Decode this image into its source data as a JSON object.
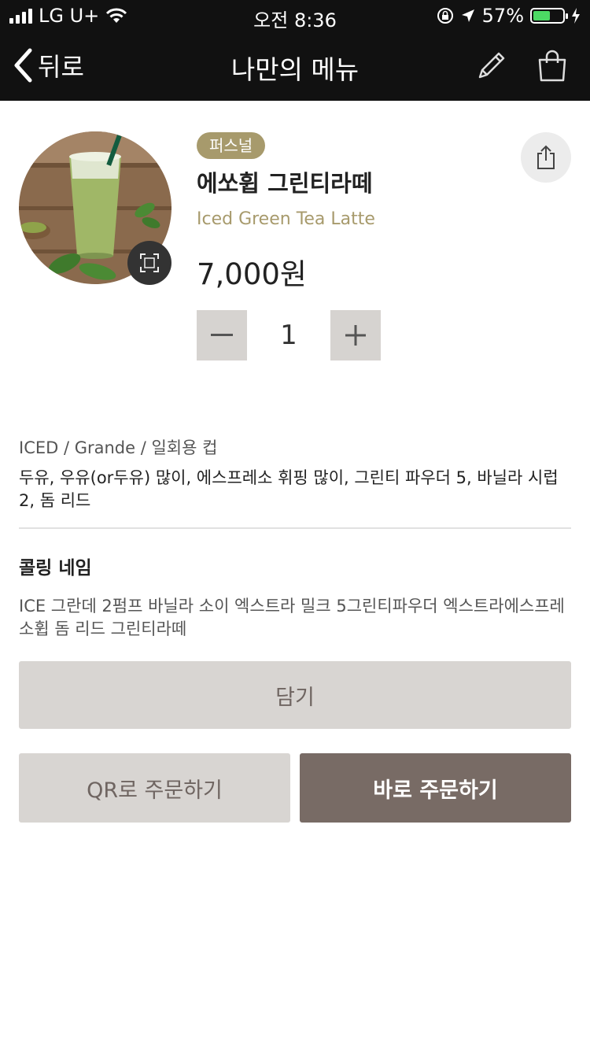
{
  "status_bar": {
    "carrier": "LG U+",
    "time": "오전 8:36",
    "battery_pct": "57%",
    "battery_level": 0.57
  },
  "nav": {
    "back_label": "뒤로",
    "title": "나만의 메뉴"
  },
  "icons": {
    "edit": "pencil-icon",
    "bag": "shopping-bag-icon",
    "share": "share-icon",
    "zoom": "fullscreen-icon"
  },
  "product": {
    "badge": "퍼스널",
    "name_ko": "에쏘휩 그린티라떼",
    "name_en": "Iced Green Tea Latte",
    "price": "7,000원",
    "quantity": "1"
  },
  "details": {
    "options": "ICED / Grande / 일회용 컵",
    "customization": "두유, 우유(or두유) 많이, 에스프레소 휘핑 많이, 그린티 파우더 5, 바닐라 시럽 2, 돔 리드"
  },
  "calling_name": {
    "label": "콜링 네임",
    "value": "ICE 그란데 2펌프 바닐라 소이 엑스트라 밀크 5그린티파우더 엑스트라에스프레소휩 돔 리드 그린티라떼"
  },
  "buttons": {
    "add": "담기",
    "qr_order": "QR로 주문하기",
    "order_now": "바로 주문하기"
  },
  "colors": {
    "accent": "#a79a6c",
    "primary_button": "#786b65",
    "secondary_button": "#d8d5d2"
  }
}
